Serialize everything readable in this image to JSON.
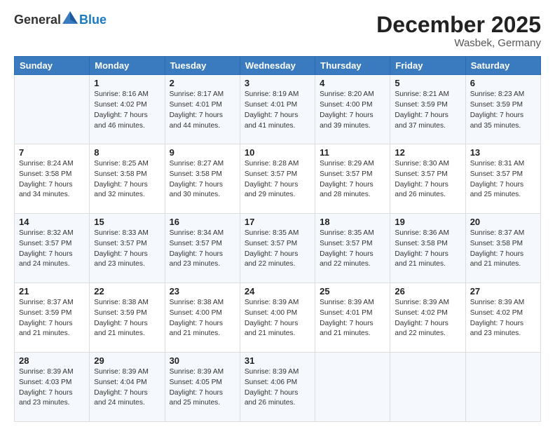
{
  "header": {
    "logo_general": "General",
    "logo_blue": "Blue",
    "month_title": "December 2025",
    "location": "Wasbek, Germany"
  },
  "days_of_week": [
    "Sunday",
    "Monday",
    "Tuesday",
    "Wednesday",
    "Thursday",
    "Friday",
    "Saturday"
  ],
  "weeks": [
    [
      {
        "day": "",
        "info": ""
      },
      {
        "day": "1",
        "info": "Sunrise: 8:16 AM\nSunset: 4:02 PM\nDaylight: 7 hours\nand 46 minutes."
      },
      {
        "day": "2",
        "info": "Sunrise: 8:17 AM\nSunset: 4:01 PM\nDaylight: 7 hours\nand 44 minutes."
      },
      {
        "day": "3",
        "info": "Sunrise: 8:19 AM\nSunset: 4:01 PM\nDaylight: 7 hours\nand 41 minutes."
      },
      {
        "day": "4",
        "info": "Sunrise: 8:20 AM\nSunset: 4:00 PM\nDaylight: 7 hours\nand 39 minutes."
      },
      {
        "day": "5",
        "info": "Sunrise: 8:21 AM\nSunset: 3:59 PM\nDaylight: 7 hours\nand 37 minutes."
      },
      {
        "day": "6",
        "info": "Sunrise: 8:23 AM\nSunset: 3:59 PM\nDaylight: 7 hours\nand 35 minutes."
      }
    ],
    [
      {
        "day": "7",
        "info": "Sunrise: 8:24 AM\nSunset: 3:58 PM\nDaylight: 7 hours\nand 34 minutes."
      },
      {
        "day": "8",
        "info": "Sunrise: 8:25 AM\nSunset: 3:58 PM\nDaylight: 7 hours\nand 32 minutes."
      },
      {
        "day": "9",
        "info": "Sunrise: 8:27 AM\nSunset: 3:58 PM\nDaylight: 7 hours\nand 30 minutes."
      },
      {
        "day": "10",
        "info": "Sunrise: 8:28 AM\nSunset: 3:57 PM\nDaylight: 7 hours\nand 29 minutes."
      },
      {
        "day": "11",
        "info": "Sunrise: 8:29 AM\nSunset: 3:57 PM\nDaylight: 7 hours\nand 28 minutes."
      },
      {
        "day": "12",
        "info": "Sunrise: 8:30 AM\nSunset: 3:57 PM\nDaylight: 7 hours\nand 26 minutes."
      },
      {
        "day": "13",
        "info": "Sunrise: 8:31 AM\nSunset: 3:57 PM\nDaylight: 7 hours\nand 25 minutes."
      }
    ],
    [
      {
        "day": "14",
        "info": "Sunrise: 8:32 AM\nSunset: 3:57 PM\nDaylight: 7 hours\nand 24 minutes."
      },
      {
        "day": "15",
        "info": "Sunrise: 8:33 AM\nSunset: 3:57 PM\nDaylight: 7 hours\nand 23 minutes."
      },
      {
        "day": "16",
        "info": "Sunrise: 8:34 AM\nSunset: 3:57 PM\nDaylight: 7 hours\nand 23 minutes."
      },
      {
        "day": "17",
        "info": "Sunrise: 8:35 AM\nSunset: 3:57 PM\nDaylight: 7 hours\nand 22 minutes."
      },
      {
        "day": "18",
        "info": "Sunrise: 8:35 AM\nSunset: 3:57 PM\nDaylight: 7 hours\nand 22 minutes."
      },
      {
        "day": "19",
        "info": "Sunrise: 8:36 AM\nSunset: 3:58 PM\nDaylight: 7 hours\nand 21 minutes."
      },
      {
        "day": "20",
        "info": "Sunrise: 8:37 AM\nSunset: 3:58 PM\nDaylight: 7 hours\nand 21 minutes."
      }
    ],
    [
      {
        "day": "21",
        "info": "Sunrise: 8:37 AM\nSunset: 3:59 PM\nDaylight: 7 hours\nand 21 minutes."
      },
      {
        "day": "22",
        "info": "Sunrise: 8:38 AM\nSunset: 3:59 PM\nDaylight: 7 hours\nand 21 minutes."
      },
      {
        "day": "23",
        "info": "Sunrise: 8:38 AM\nSunset: 4:00 PM\nDaylight: 7 hours\nand 21 minutes."
      },
      {
        "day": "24",
        "info": "Sunrise: 8:39 AM\nSunset: 4:00 PM\nDaylight: 7 hours\nand 21 minutes."
      },
      {
        "day": "25",
        "info": "Sunrise: 8:39 AM\nSunset: 4:01 PM\nDaylight: 7 hours\nand 21 minutes."
      },
      {
        "day": "26",
        "info": "Sunrise: 8:39 AM\nSunset: 4:02 PM\nDaylight: 7 hours\nand 22 minutes."
      },
      {
        "day": "27",
        "info": "Sunrise: 8:39 AM\nSunset: 4:02 PM\nDaylight: 7 hours\nand 23 minutes."
      }
    ],
    [
      {
        "day": "28",
        "info": "Sunrise: 8:39 AM\nSunset: 4:03 PM\nDaylight: 7 hours\nand 23 minutes."
      },
      {
        "day": "29",
        "info": "Sunrise: 8:39 AM\nSunset: 4:04 PM\nDaylight: 7 hours\nand 24 minutes."
      },
      {
        "day": "30",
        "info": "Sunrise: 8:39 AM\nSunset: 4:05 PM\nDaylight: 7 hours\nand 25 minutes."
      },
      {
        "day": "31",
        "info": "Sunrise: 8:39 AM\nSunset: 4:06 PM\nDaylight: 7 hours\nand 26 minutes."
      },
      {
        "day": "",
        "info": ""
      },
      {
        "day": "",
        "info": ""
      },
      {
        "day": "",
        "info": ""
      }
    ]
  ]
}
